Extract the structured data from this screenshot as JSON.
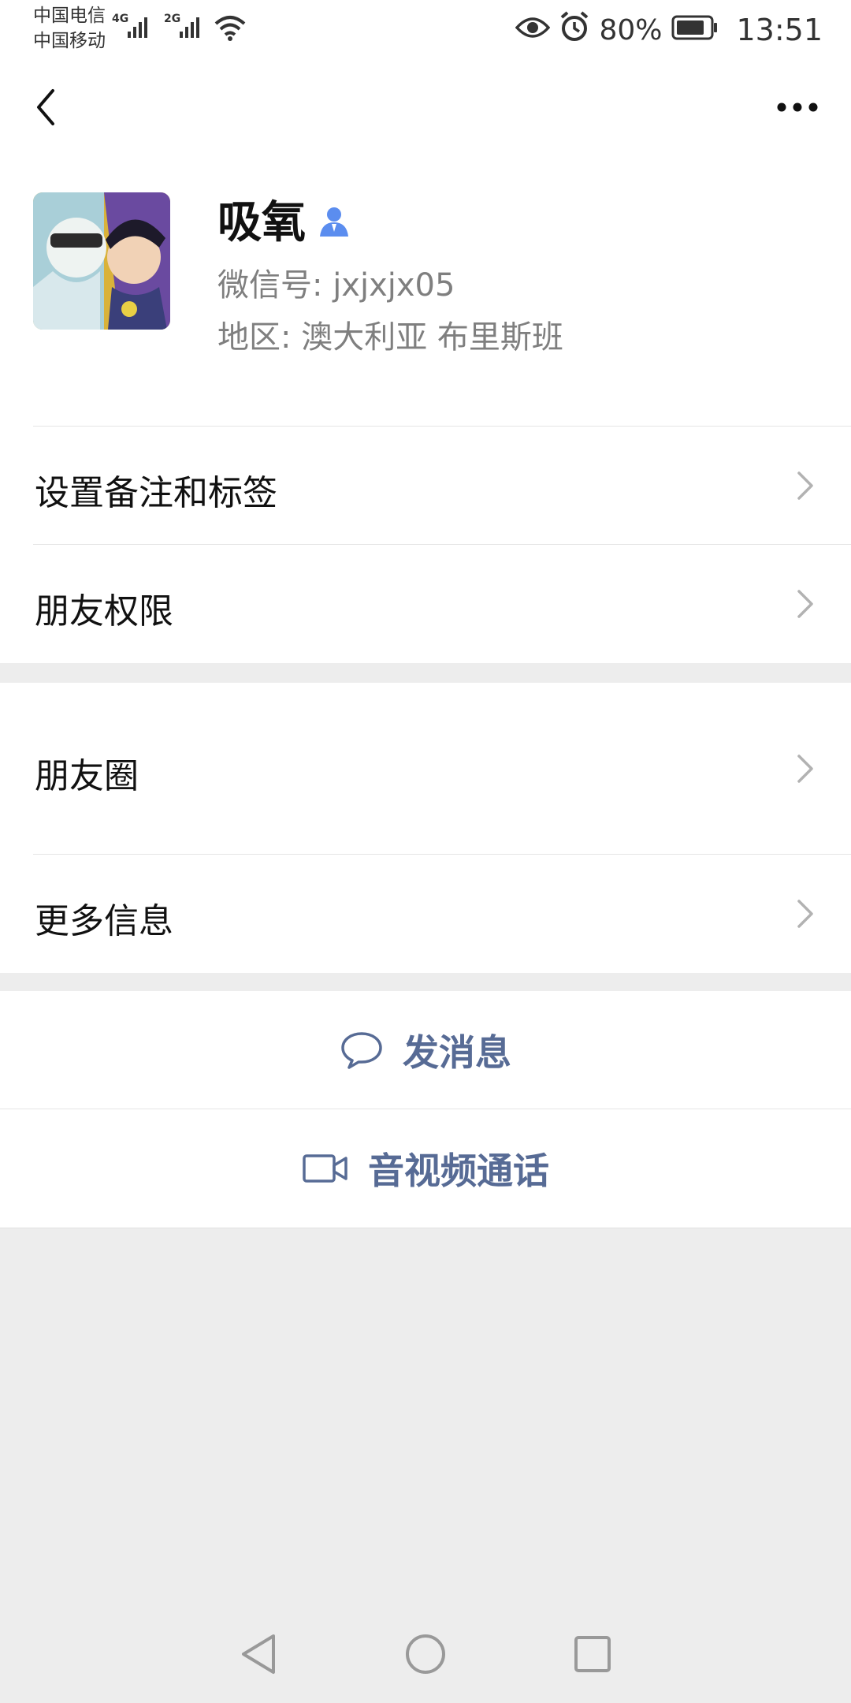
{
  "status_bar": {
    "carrier_1": "中国电信",
    "carrier_2": "中国移动",
    "network_1": "4G",
    "network_2": "2G",
    "battery_percent": "80%",
    "time": "13:51",
    "icons": [
      "signal-icon",
      "wifi-icon",
      "eye-icon",
      "alarm-icon",
      "battery-icon"
    ]
  },
  "header": {
    "back_icon": "chevron-left-icon",
    "more_icon": "more-dots-icon"
  },
  "profile": {
    "name": "吸氧",
    "wechat_id": "微信号:  jxjxjx05",
    "region": "地区:  澳大利亚  布里斯班",
    "contact_icon": "contact-person-icon"
  },
  "menu_group_1": [
    {
      "label": "设置备注和标签"
    },
    {
      "label": "朋友权限"
    }
  ],
  "menu_group_2": [
    {
      "label": "朋友圈"
    },
    {
      "label": "更多信息"
    }
  ],
  "actions": {
    "message_label": "发消息",
    "call_label": "音视频通话"
  },
  "colors": {
    "background": "#ededed",
    "link_blue": "#576b95",
    "contact_icon_blue": "#5b8def"
  }
}
